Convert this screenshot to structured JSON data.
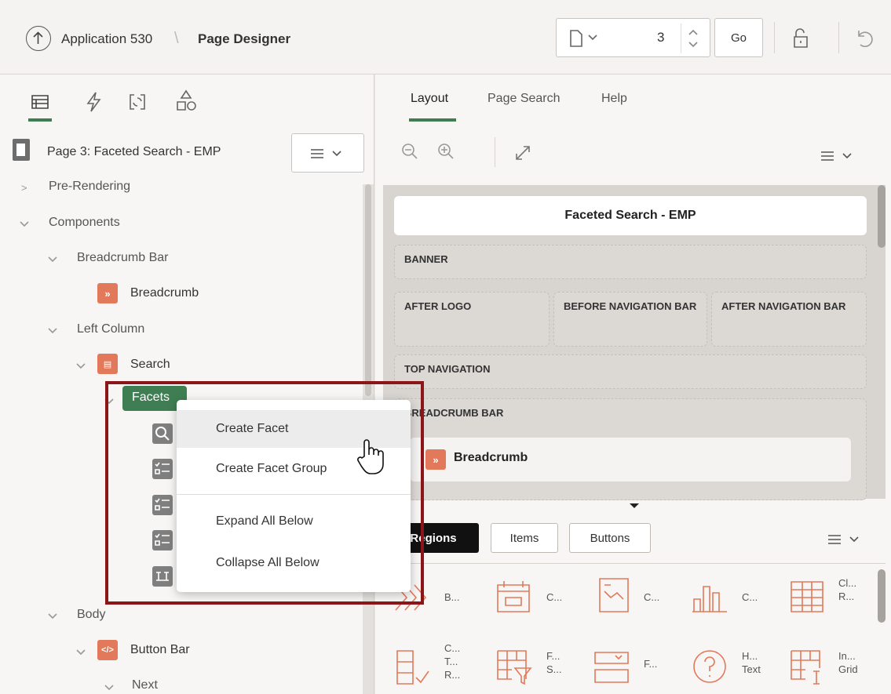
{
  "header": {
    "app_label": "Application 530",
    "separator": "\\",
    "page_designer_label": "Page Designer",
    "page_number": "3",
    "go_label": "Go"
  },
  "left": {
    "page_title": "Page 3: Faceted Search - EMP",
    "tree": {
      "pre_rendering": "Pre-Rendering",
      "components": "Components",
      "breadcrumb_bar": "Breadcrumb Bar",
      "breadcrumb": "Breadcrumb",
      "left_column": "Left Column",
      "search": "Search",
      "facets": "Facets",
      "body": "Body",
      "button_bar": "Button Bar",
      "next": "Next"
    }
  },
  "right": {
    "tabs": [
      "Layout",
      "Page Search",
      "Help"
    ],
    "layout": {
      "page_title": "Faceted Search - EMP",
      "banner": "BANNER",
      "after_logo": "AFTER LOGO",
      "before_nav_bar": "BEFORE NAVIGATION BAR",
      "after_nav_bar": "AFTER NAVIGATION BAR",
      "top_navigation": "TOP NAVIGATION",
      "breadcrumb_bar": "BREADCRUMB BAR",
      "breadcrumb_region": "Breadcrumb"
    },
    "gallery_tabs": [
      "Regions",
      "Items",
      "Buttons"
    ],
    "components": [
      [
        "B..."
      ],
      [
        "C..."
      ],
      [
        "C..."
      ],
      [
        "C..."
      ],
      [
        "Cl...",
        "R..."
      ],
      [
        "C...",
        "T...",
        "R..."
      ],
      [
        "F...",
        "S..."
      ],
      [
        "F..."
      ],
      [
        "H...",
        "Text"
      ],
      [
        "In...",
        "Grid"
      ]
    ]
  },
  "context_menu": {
    "items": [
      "Create Facet",
      "Create Facet Group",
      "Expand All Below",
      "Collapse All Below"
    ]
  },
  "colors": {
    "accent_green": "#3f7e53",
    "region_orange": "#e2795a",
    "highlight_red": "#8b1518",
    "active_tab_dark": "#111111"
  }
}
